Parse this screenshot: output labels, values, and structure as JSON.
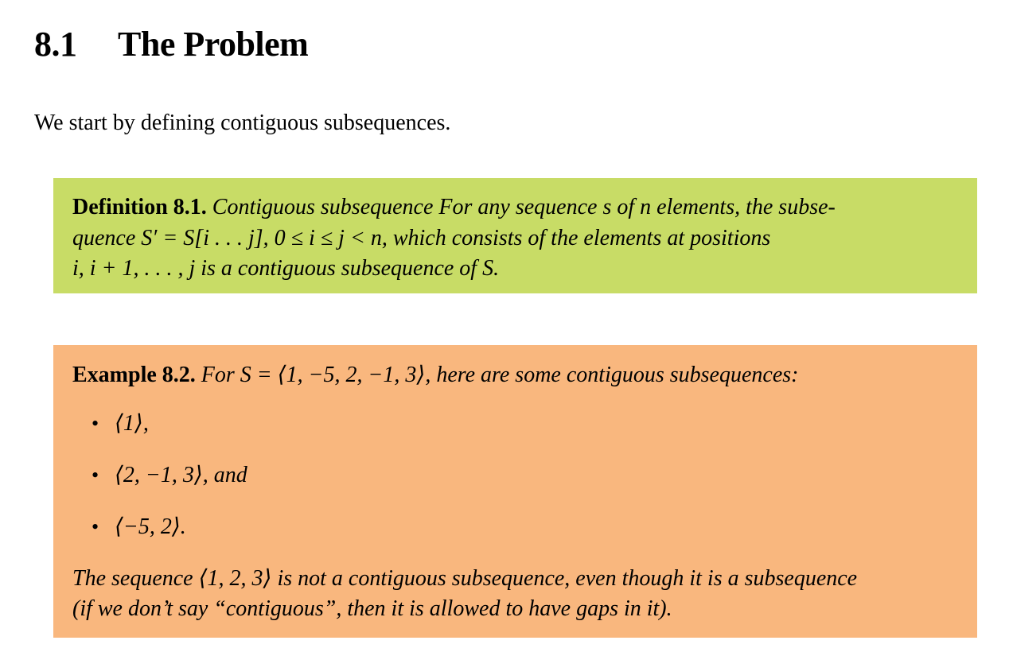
{
  "section": {
    "number": "8.1",
    "title": "The Problem"
  },
  "intro": "We start by defining contiguous subsequences.",
  "definition": {
    "label": "Definition 8.1.",
    "line1": "Contiguous subsequence For any sequence s of n elements, the subse-",
    "line2": "quence S′ = S[i . . . j], 0 ≤ i ≤ j < n, which consists of the elements at positions",
    "line3": "i, i + 1, . . . , j is a contiguous subsequence of S."
  },
  "example": {
    "label": "Example 8.2.",
    "intro": "For S = ⟨1, −5, 2, −1, 3⟩, here are some contiguous subsequences:",
    "items": [
      "⟨1⟩,",
      "⟨2, −1, 3⟩, and",
      "⟨−5, 2⟩."
    ],
    "bullet": "•",
    "closing_line1": "The sequence ⟨1, 2, 3⟩ is not a contiguous subsequence, even though it is a subsequence",
    "closing_line2": "(if we don’t say “contiguous”, then it is allowed to have gaps in it)."
  },
  "colors": {
    "definition_background": "#c8dc66",
    "example_background": "#f9b77e"
  }
}
